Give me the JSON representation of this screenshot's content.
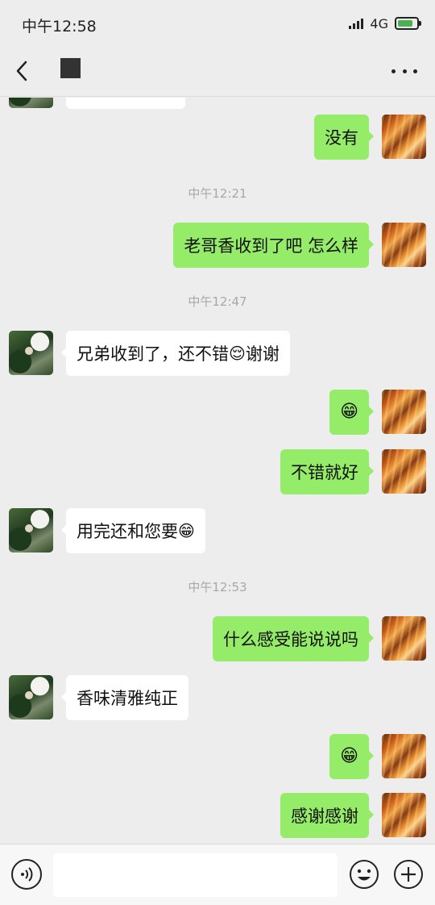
{
  "status_bar": {
    "time": "中午12:58",
    "network": "4G",
    "battery_level": 0.8,
    "colors": {
      "battery_fill": "#4caf50"
    }
  },
  "nav": {
    "back_icon": "chevron-left-icon",
    "more_icon": "more-horizontal-icon"
  },
  "colors": {
    "outgoing_bubble": "#95ec69",
    "incoming_bubble": "#ffffff",
    "background": "#ededed",
    "timestamp": "#a8a8a8"
  },
  "timestamps": [
    "中午12:21",
    "中午12:47",
    "中午12:53"
  ],
  "messages": [
    {
      "direction": "out",
      "text": "没有"
    },
    {
      "direction": "out",
      "text": "老哥香收到了吧 怎么样"
    },
    {
      "direction": "in",
      "text": "兄弟收到了，还不错",
      "emoji": "😌",
      "text_after": "谢谢"
    },
    {
      "direction": "out",
      "emoji": "😁"
    },
    {
      "direction": "out",
      "text": "不错就好"
    },
    {
      "direction": "in",
      "text": "用完还和您要",
      "emoji": "😁"
    },
    {
      "direction": "out",
      "text": "什么感受能说说吗"
    },
    {
      "direction": "in",
      "text": "香味清雅纯正"
    },
    {
      "direction": "out",
      "emoji": "😁"
    },
    {
      "direction": "out",
      "text": "感谢感谢"
    }
  ],
  "input_bar": {
    "voice_icon": "voice-icon",
    "emoji_icon": "emoji-icon",
    "plus_icon": "plus-icon",
    "value": ""
  }
}
